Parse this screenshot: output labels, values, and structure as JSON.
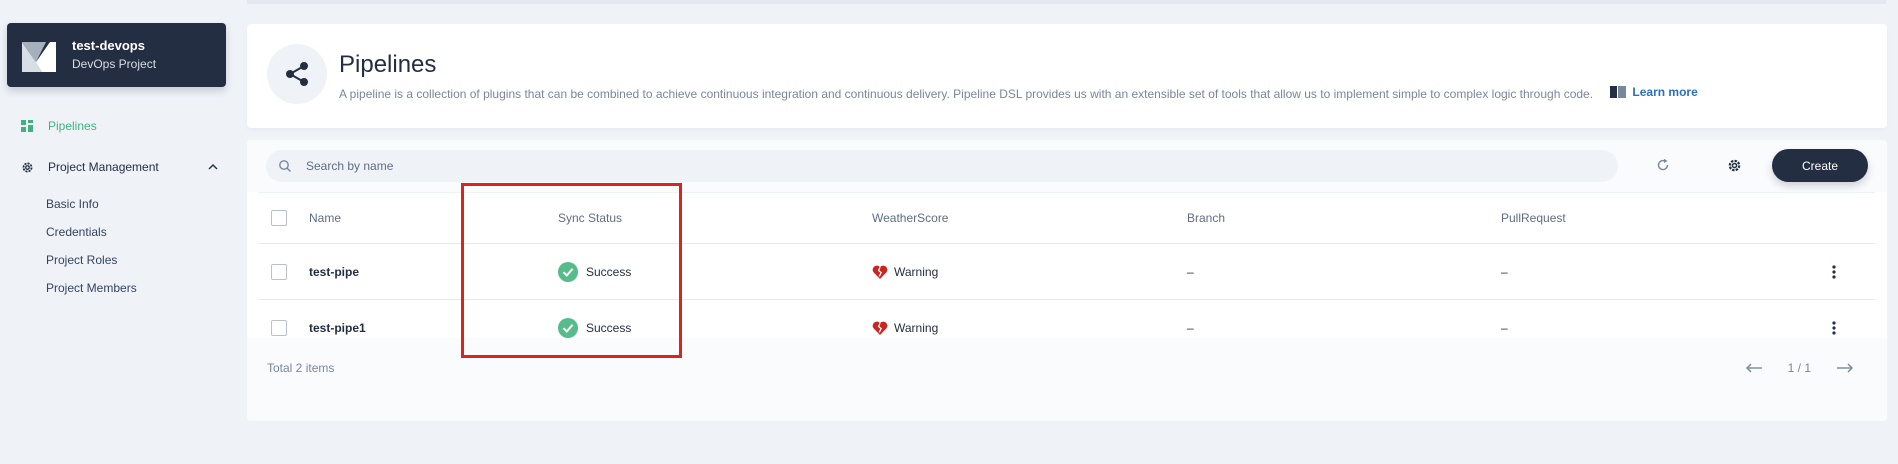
{
  "project": {
    "name": "test-devops",
    "type": "DevOps Project"
  },
  "nav": {
    "pipelines": "Pipelines",
    "project_management": "Project Management",
    "sub_items": [
      "Basic Info",
      "Credentials",
      "Project Roles",
      "Project Members"
    ]
  },
  "header": {
    "title": "Pipelines",
    "description": "A pipeline is a collection of plugins that can be combined to achieve continuous integration and continuous delivery. Pipeline DSL provides us with an extensible set of tools that allow us to implement simple to complex logic through code.",
    "learn_more": "Learn more"
  },
  "toolbar": {
    "search_placeholder": "Search by name",
    "create_label": "Create"
  },
  "table": {
    "columns": [
      "Name",
      "Sync Status",
      "WeatherScore",
      "Branch",
      "PullRequest"
    ],
    "rows": [
      {
        "name": "test-pipe",
        "sync_status": "Success",
        "weather": "Warning",
        "branch": "–",
        "pull_request": "–"
      },
      {
        "name": "test-pipe1",
        "sync_status": "Success",
        "weather": "Warning",
        "branch": "–",
        "pull_request": "–"
      }
    ]
  },
  "footer": {
    "total": "Total 2 items",
    "page": "1 / 1"
  },
  "colors": {
    "accent": "#3fb27f",
    "dark": "#242e42",
    "highlight": "#d9261c",
    "success": "#55bc8a",
    "warning_heart": "#ca2621"
  }
}
